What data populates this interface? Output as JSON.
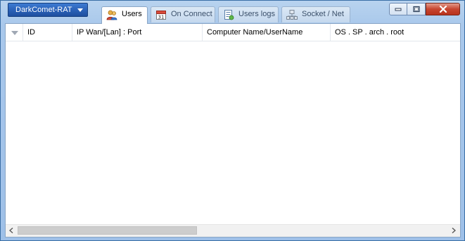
{
  "app": {
    "menu_label": "DarkComet-RAT"
  },
  "tabs": [
    {
      "label": "Users",
      "icon": "users-icon",
      "active": true
    },
    {
      "label": "On Connect",
      "icon": "calendar-icon",
      "active": false
    },
    {
      "label": "Users logs",
      "icon": "log-document-icon",
      "active": false
    },
    {
      "label": "Socket / Net",
      "icon": "network-icon",
      "active": false
    }
  ],
  "window_controls": {
    "minimize": "minimize-icon",
    "maximize": "maximize-icon",
    "close": "close-icon"
  },
  "grid": {
    "columns": [
      {
        "label": "ID"
      },
      {
        "label": "IP Wan/[Lan] : Port"
      },
      {
        "label": "Computer Name/UserName"
      },
      {
        "label": "OS . SP . arch . root"
      }
    ],
    "rows": []
  },
  "colors": {
    "frame": "#a9c8eb",
    "app_button": "#2b62b8",
    "close_button": "#c7452f"
  }
}
